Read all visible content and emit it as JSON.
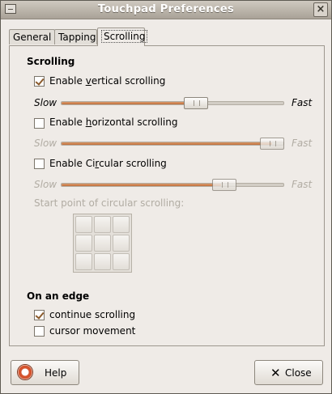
{
  "window": {
    "title": "Touchpad Preferences"
  },
  "tabs": [
    {
      "label": "General"
    },
    {
      "label": "Tapping"
    },
    {
      "label": "Scrolling",
      "active": true
    }
  ],
  "scrolling": {
    "section_title": "Scrolling",
    "vertical": {
      "label": "Enable vertical scrolling",
      "checked": true,
      "enabled": true,
      "slider_level": 0.59
    },
    "horizontal": {
      "label": "Enable horizontal scrolling",
      "checked": false,
      "enabled": false,
      "slider_level": 0.97
    },
    "circular": {
      "label": "Enable Circular scrolling",
      "checked": false,
      "enabled": false,
      "slider_level": 0.71
    },
    "slow_label": "Slow",
    "fast_label": "Fast",
    "start_point_label": "Start point of circular scrolling:"
  },
  "edge": {
    "section_title": "On an edge",
    "continue": {
      "label": "continue scrolling",
      "checked": true
    },
    "cursor": {
      "label": "cursor movement",
      "checked": false
    }
  },
  "buttons": {
    "help": "Help",
    "close": "Close"
  }
}
